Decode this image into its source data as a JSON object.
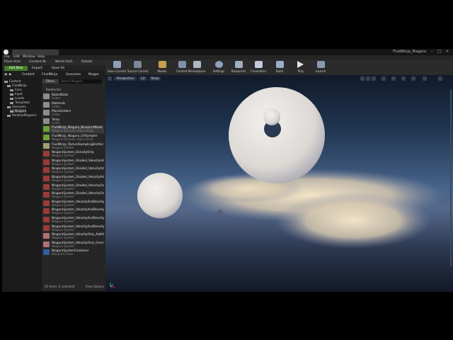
{
  "window": {
    "project_title": "FluidNinja_Niagara",
    "menu": [
      "File",
      "Edit",
      "Window",
      "Help"
    ]
  },
  "left_tabs": [
    "Place Acts",
    "Content Br.",
    "World Outl.",
    "Details"
  ],
  "toolbar": {
    "buttons": [
      "Save Current",
      "Source Control",
      "Modes",
      "Content",
      "Marketplace",
      "Settings",
      "Blueprints",
      "Cinematics",
      "Build",
      "Play",
      "Launch"
    ]
  },
  "content_browser": {
    "add_new": "Add New",
    "import": "Import",
    "save_all": "Save All",
    "path": [
      "Content",
      "FluidNinja",
      "Usecases",
      "Niagar"
    ],
    "filters": "Filters",
    "search_placeholder": "Search Niagara",
    "current_folder": "Redirector",
    "status": "20 items (1 selected)",
    "view_options": "View Options"
  },
  "tree": [
    {
      "label": "Content",
      "depth": 0
    },
    {
      "label": "FluidNinja",
      "depth": 1
    },
    {
      "label": "Core",
      "depth": 2
    },
    {
      "label": "Input",
      "depth": 2
    },
    {
      "label": "Levels",
      "depth": 2
    },
    {
      "label": "Templates",
      "depth": 2
    },
    {
      "label": "Usecases",
      "depth": 1
    },
    {
      "label": "Niagara",
      "depth": 2
    },
    {
      "label": "ParallaxMappers",
      "depth": 1
    }
  ],
  "assets": [
    {
      "name": "BakedData",
      "type": "Folder",
      "kind": "folder"
    },
    {
      "name": "Materials",
      "type": "Folder",
      "kind": "folder"
    },
    {
      "name": "PlaceHolders",
      "type": "Folder",
      "kind": "folder"
    },
    {
      "name": "Temp",
      "type": "Folder",
      "kind": "folder"
    },
    {
      "name": "FluidNinja_Niagara_BlueprintNode",
      "type": "Niagara Dynamic Input Script",
      "kind": "script",
      "selected": true
    },
    {
      "name": "FluidNinja_Niagara_UVSampler",
      "type": "Niagara Dynamic Input Script",
      "kind": "script"
    },
    {
      "name": "FluidNinja_TextureSamplingEmitter",
      "type": "Niagara Emitter",
      "kind": "emitter"
    },
    {
      "name": "NiagaraSystem_DensityOnly",
      "type": "Niagara System",
      "kind": "system"
    },
    {
      "name": "NiagaraSystem_Shaded_VelocityAdditive",
      "type": "Niagara System",
      "kind": "system"
    },
    {
      "name": "NiagaraSystem_Shaded_VelocityAdditive_MI",
      "type": "Niagara System",
      "kind": "system"
    },
    {
      "name": "NiagaraSystem_Shaded_VelocityAdditive_MI",
      "type": "Niagara System",
      "kind": "system"
    },
    {
      "name": "NiagaraSystem_Shaded_VelocityOverride",
      "type": "Niagara System",
      "kind": "system"
    },
    {
      "name": "NiagaraSystem_Shaded_VelocityOverride_SC",
      "type": "Niagara System",
      "kind": "system"
    },
    {
      "name": "NiagaraSystem_VelocityAndDensity_VelocityAdd",
      "type": "Niagara System",
      "kind": "system"
    },
    {
      "name": "NiagaraSystem_VelocityAndDensity_VelocityAdd",
      "type": "Niagara System",
      "kind": "system"
    },
    {
      "name": "NiagaraSystem_VelocityAndDensity_VelocityAdd",
      "type": "Niagara System",
      "kind": "system"
    },
    {
      "name": "NiagaraSystem_VelocityAndDensity_VelocityOverride",
      "type": "Niagara System",
      "kind": "system"
    },
    {
      "name": "NiagaraSystem_VelocityOnly_Additive",
      "type": "Niagara System",
      "kind": "system2"
    },
    {
      "name": "NiagaraSystem_VelocityOnly_Override",
      "type": "Niagara System",
      "kind": "system2"
    },
    {
      "name": "NiagaraSystemContainer",
      "type": "Blueprint Class",
      "kind": "blueprint"
    }
  ],
  "viewport": {
    "perspective": "Perspective",
    "lit": "Lit",
    "show": "Show"
  },
  "colors": {
    "folder": "#8c8c8c",
    "script": "#6ea035",
    "emitter": "#a0a070",
    "system": "#9a3a3a",
    "system2": "#b07070",
    "blueprint": "#2f5fa0",
    "add_new": "#3e7d2a"
  }
}
